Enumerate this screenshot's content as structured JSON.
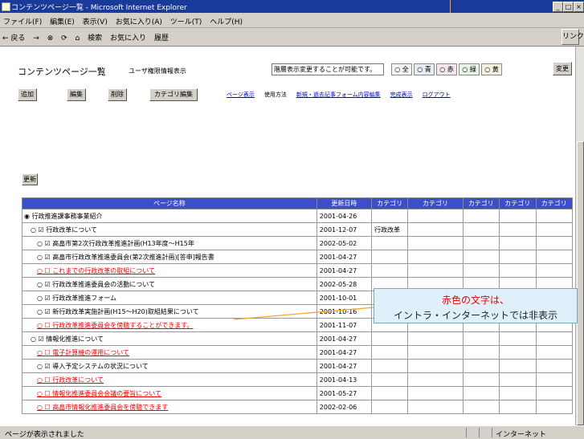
{
  "window": {
    "title": "コンテンツページ一覧 - Microsoft Internet Explorer"
  },
  "menu": [
    "ファイル(F)",
    "編集(E)",
    "表示(V)",
    "お気に入り(A)",
    "ツール(T)",
    "ヘルプ(H)"
  ],
  "toolbar": {
    "items": [
      "← 戻る",
      "→",
      "⊗",
      "⟳",
      "⌂",
      "検索",
      "お気に入り",
      "履歴"
    ],
    "go": "リンク"
  },
  "page": {
    "title": "コンテンツページ一覧",
    "sub_link": "ユーザ権限情報表示",
    "hint": "階層表示変更することが可能です。",
    "radios": [
      "○ 全",
      "○ 青",
      "○ 赤",
      "○ 緑",
      "○ 黄"
    ],
    "apply": "変更",
    "buttons": {
      "add": "追加",
      "edit": "編集",
      "delete": "削除",
      "category": "カテゴリ編集"
    },
    "links": [
      "ページ表示",
      "使用方法",
      "新規・過去記事フォーム内容編集",
      "完成表示",
      "ログアウト"
    ],
    "refresh": "更新"
  },
  "table": {
    "headers": [
      "ページ名称",
      "更新日時",
      "カテゴリ",
      "カテゴリ",
      "カテゴリ",
      "カテゴリ",
      "カテゴリ"
    ],
    "rows": [
      {
        "name": "◉ 行政推進課事務事業紹介",
        "date": "2001-04-26",
        "cat1": "",
        "red": false
      },
      {
        "name": "○ ☑ 行政改革について",
        "date": "2001-12-07",
        "cat1": "行政改革",
        "red": false
      },
      {
        "name": "○ ☑ 高畠市第2次行政改革推進計画(H13年度〜H15年",
        "date": "2002-05-02",
        "cat1": "",
        "red": false
      },
      {
        "name": "○ ☑ 高畠市行政改革推進委員会(第2次推進計画)[答申]報告書",
        "date": "2001-04-27",
        "cat1": "",
        "red": false
      },
      {
        "name": "○ ☐ これまでの行政改革の取組について",
        "date": "2001-04-27",
        "cat1": "",
        "red": true
      },
      {
        "name": "○ ☑ 行政改革推進委員会の活動について",
        "date": "2002-05-28",
        "cat1": "",
        "red": false
      },
      {
        "name": "○ ☑ 行政改革推進フォーム",
        "date": "2001-10-01",
        "cat1": "",
        "red": false
      },
      {
        "name": "○ ☑ 新行政改革実施計画(H15〜H20)取組結果について",
        "date": "2001-10-16",
        "cat1": "",
        "red": false
      },
      {
        "name": "○ ☐ 行政改革推進委員会を傍聴することができます。",
        "date": "2001-11-07",
        "cat1": "",
        "red": true
      },
      {
        "name": "○ ☑ 情報化推進について",
        "date": "2001-04-27",
        "cat1": "",
        "red": false
      },
      {
        "name": "○ ☐ 電子計算機の運用について",
        "date": "2001-04-27",
        "cat1": "",
        "red": true
      },
      {
        "name": "○ ☑ 導入予定システムの状況について",
        "date": "2001-04-27",
        "cat1": "",
        "red": false
      },
      {
        "name": "○ ☐ 行政改革について",
        "date": "2001-04-13",
        "cat1": "",
        "red": true
      },
      {
        "name": "○ ☐ 情報化推進委員会会議の要旨について",
        "date": "2001-05-27",
        "cat1": "",
        "red": true
      },
      {
        "name": "○ ☐ 高畠市情報化推進委員会を傍聴できます",
        "date": "2002-02-06",
        "cat1": "",
        "red": true
      }
    ]
  },
  "callout": {
    "line1": "赤色の文字は、",
    "line2": "イントラ・インターネットでは非表示"
  },
  "status": {
    "left": "ページが表示されました",
    "right": "インターネット"
  }
}
